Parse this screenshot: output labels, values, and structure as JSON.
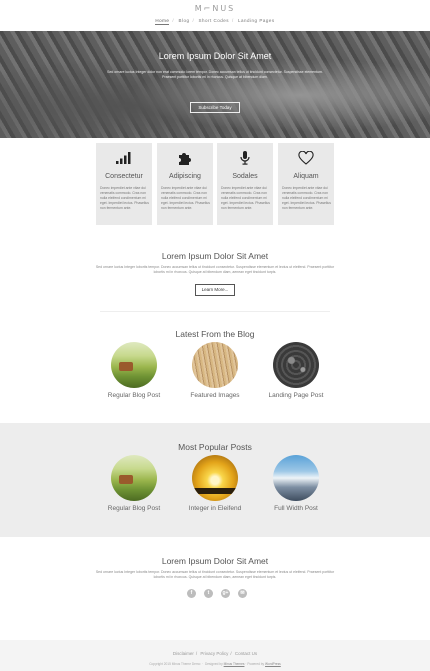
{
  "header": {
    "logo": "M⌐NUS",
    "nav": [
      "Home",
      "Blog",
      "Short Codes",
      "Landing Pages"
    ]
  },
  "hero": {
    "title": "Lorem Ipsum Dolor Sit Amet",
    "text": "Sed ornare luctus Integer dolor non erat commodo lorem tempor. Donec accumsan tellus ut tincidunt consectetur. Suspendisse elementum. Praesent porttitor lobortis mi in rhoncus. Quisque at bibendum diam.",
    "button": "Subscribe Today"
  },
  "features": [
    {
      "icon": "signal-bars-icon",
      "title": "Consectetur",
      "text": "Donec imperdiet ante vitae dui venenatis commodo. Cras non nulla eleifend condimentum mi eget. Imperdiet lectus. Phasellus non fermentum ante."
    },
    {
      "icon": "puzzle-icon",
      "title": "Adipiscing",
      "text": "Donec imperdiet ante vitae dui venenatis commodo. Cras non nulla eleifend condimentum mi eget. Imperdiet lectus. Phasellus non fermentum ante."
    },
    {
      "icon": "microphone-icon",
      "title": "Sodales",
      "text": "Donec imperdiet ante vitae dui venenatis commodo. Cras non nulla eleifend condimentum mi eget. Imperdiet lectus. Phasellus non fermentum ante."
    },
    {
      "icon": "heart-icon",
      "title": "Aliquam",
      "text": "Donec imperdiet ante vitae dui venenatis commodo. Cras non nulla eleifend condimentum mi eget. Imperdiet lectus. Phasellus non fermentum ante."
    }
  ],
  "intro": {
    "title": "Lorem Ipsum Dolor Sit Amet",
    "text": "Sed ornare luctus Integer lobortis tempor. Donec accumsan tellus ut tincidunt consectetur. Suspendisse elementum et lectus ut eleifend. Praesent porttitor lobortis mi in rhoncus. Quisque at bibendum diam, aenean eget tincidunt turpis.",
    "button": "Learn More..."
  },
  "blog": {
    "title": "Latest From the Blog",
    "posts": [
      "Regular Blog Post",
      "Featured Images",
      "Landing Page Post"
    ]
  },
  "popular": {
    "title": "Most Popular Posts",
    "posts": [
      "Regular Blog Post",
      "Integer in Eleifend",
      "Full Width Post"
    ]
  },
  "outro": {
    "title": "Lorem Ipsum Dolor Sit Amet",
    "text": "Sed ornare luctus Integer lobortis tempor. Donec accumsan tellus ut tincidunt consectetur. Suspendisse elementum et lectus ut eleifend. Praesent porttitor lobortis mi in rhoncus. Quisque at bibendum diam, aenean eget tincidunt turpis."
  },
  "social": [
    "f",
    "t",
    "g+",
    "✉"
  ],
  "footer": {
    "links": [
      "Disclaimer",
      "Privacy Policy",
      "Contact Us"
    ],
    "copyright": "Copyright 2015 Minus Theme Demo",
    "designed_by_label": "Designed by",
    "designer": "Minus Themes",
    "powered_by_label": "Powered by",
    "platform": "WordPress"
  }
}
